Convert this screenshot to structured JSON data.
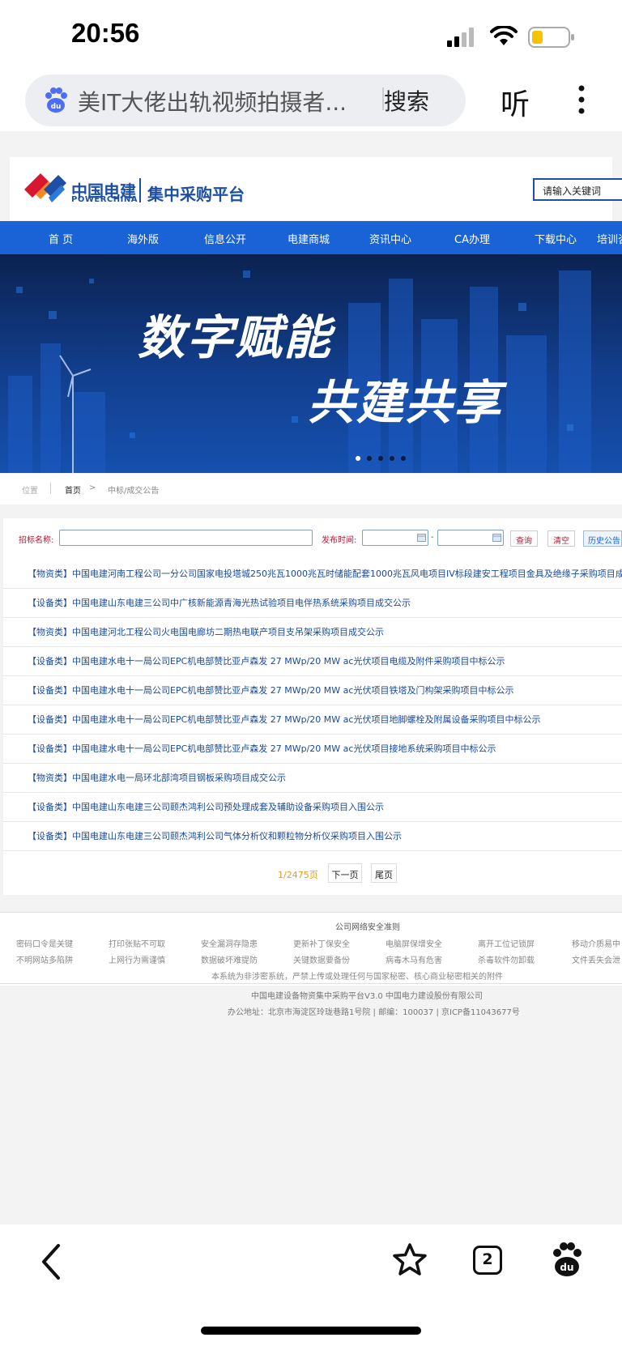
{
  "status_bar": {
    "time": "20:56"
  },
  "browser": {
    "url_title": "美IT大佬出轨视频拍摄者...",
    "search_label": "搜索",
    "listen_label": "听",
    "tab_count": "2"
  },
  "site": {
    "brand_cn": "中国电建",
    "brand_en": "POWERCHINA",
    "platform_name": "集中采购平台",
    "search_placeholder": "请输入关键词",
    "nav": [
      "首 页",
      "海外版",
      "信息公开",
      "电建商城",
      "资讯中心",
      "CA办理",
      "下载中心",
      "培训咨"
    ],
    "banner": {
      "slogan_1": "数字赋能",
      "slogan_2": "共建共享"
    },
    "breadcrumb": {
      "label": "位置",
      "home": "首页",
      "separator": ">",
      "current": "中标/成交公告"
    },
    "filter": {
      "name_label": "招标名称:",
      "date_label": "发布时间:",
      "date_sep": "-",
      "query_btn": "查询",
      "clear_btn": "清空",
      "history_btn": "历史公告"
    },
    "announcements": [
      "【物资类】中国电建河南工程公司一分公司国家电投塔城250兆瓦1000兆瓦时储能配套1000兆瓦风电项目IV标段建安工程项目金具及绝缘子采购项目成交公",
      "【设备类】中国电建山东电建三公司中广核新能源青海光热试验项目电伴热系统采购项目成交公示",
      "【物资类】中国电建河北工程公司火电国电廊坊二期热电联产项目支吊架采购项目成交公示",
      "【设备类】中国电建水电十一局公司EPC机电部赞比亚卢森发 27 MWp/20 MW ac光伏项目电缆及附件采购项目中标公示",
      "【设备类】中国电建水电十一局公司EPC机电部赞比亚卢森发 27 MWp/20 MW ac光伏项目铁塔及门构架采购项目中标公示",
      "【设备类】中国电建水电十一局公司EPC机电部赞比亚卢森发 27 MWp/20 MW ac光伏项目地脚螺栓及附属设备采购项目中标公示",
      "【设备类】中国电建水电十一局公司EPC机电部赞比亚卢森发 27 MWp/20 MW ac光伏项目接地系统采购项目中标公示",
      "【物资类】中国电建水电一局环北部湾项目钢板采购项目成交公示",
      "【设备类】中国电建山东电建三公司颐杰鸿利公司预处理成套及辅助设备采购项目入围公示",
      "【设备类】中国电建山东电建三公司颐杰鸿利公司气体分析仪和颗粒物分析仪采购项目入围公示"
    ],
    "pager": {
      "count": "1/2475页",
      "next": "下一页",
      "last": "尾页"
    },
    "footer": {
      "rules_title": "公司网络安全准则",
      "rules_row1": [
        "密码口令是关键",
        "打印张贴不可取",
        "安全漏洞存隐患",
        "更新补丁保安全",
        "电脑屏保增安全",
        "离开工位记锁屏",
        "移动介质易中"
      ],
      "rules_row2": [
        "不明网站多陷阱",
        "上网行为需谨慎",
        "数据破坏难提防",
        "关键数据要备份",
        "病毒木马有危害",
        "杀毒软件勿卸载",
        "文件丢失会泄"
      ],
      "notice": "本系统为非涉密系统，严禁上传或处理任何与国家秘密、核心商业秘密相关的附件",
      "copyright": "中国电建设备物资集中采购平台V3.0    中国电力建设股份有限公司",
      "address": "办公地址：北京市海淀区玲珑巷路1号院 | 邮编：100037 | 京ICP备11043677号"
    }
  },
  "colors": {
    "nav_blue": "#1a63d6",
    "brand_blue": "#1e4fa5",
    "link_blue": "#1a4aa2",
    "accent_red": "#c8102e",
    "pager_orange": "#f09a1a"
  }
}
